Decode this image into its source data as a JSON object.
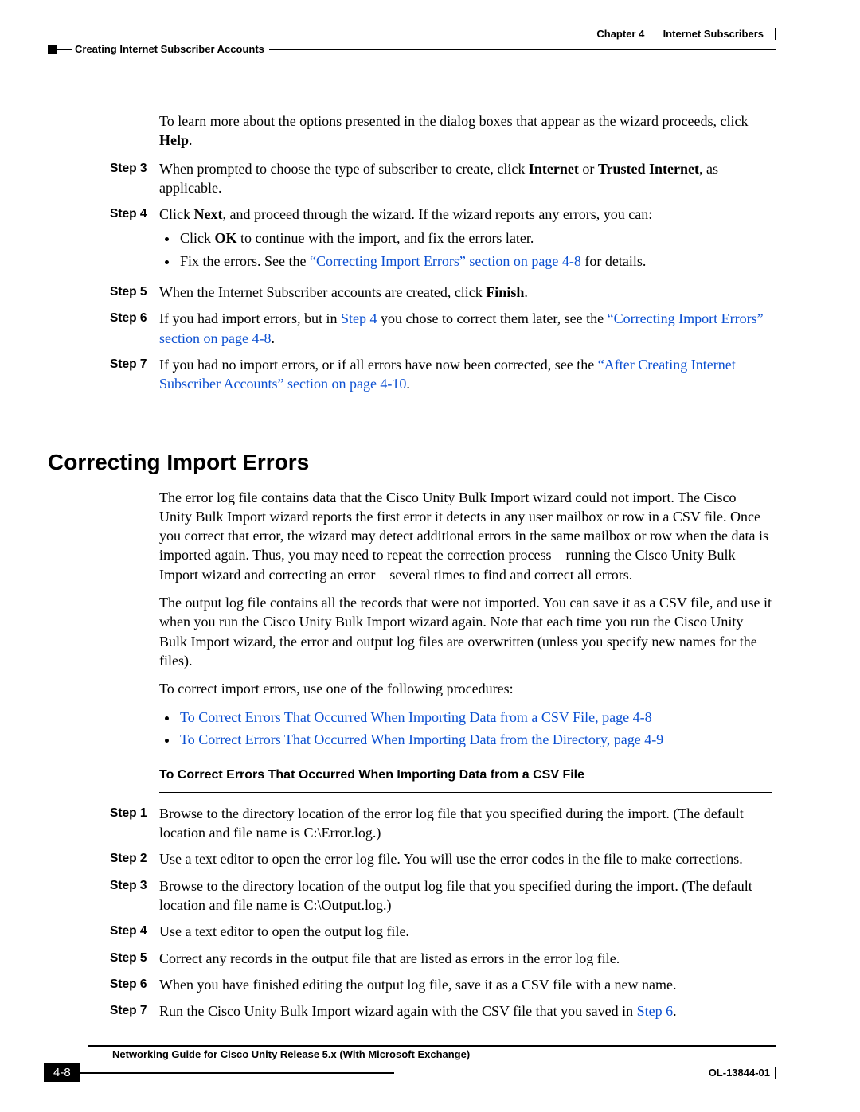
{
  "header": {
    "chapter_label": "Chapter 4",
    "chapter_title": "Internet Subscribers",
    "section": "Creating Internet Subscriber Accounts"
  },
  "intro": {
    "p1a": "To learn more about the options presented in the dialog boxes that appear as the wizard proceeds, click ",
    "help": "Help",
    "p1b": "."
  },
  "stepsA": {
    "s3": {
      "label": "Step 3",
      "a": "When prompted to choose the type of subscriber to create, click ",
      "b": "Internet",
      "c": " or ",
      "d": "Trusted Internet",
      "e": ", as applicable."
    },
    "s4": {
      "label": "Step 4",
      "a": "Click ",
      "b": "Next",
      "c": ", and proceed through the wizard. If the wizard reports any errors, you can:",
      "bullet1a": "Click ",
      "bullet1b": "OK",
      "bullet1c": " to continue with the import, and fix the errors later.",
      "bullet2a": "Fix the errors. See the ",
      "bullet2link": "“Correcting Import Errors” section on page 4-8",
      "bullet2b": " for details."
    },
    "s5": {
      "label": "Step 5",
      "a": "When the Internet Subscriber accounts are created, click ",
      "b": "Finish",
      "c": "."
    },
    "s6": {
      "label": "Step 6",
      "a": "If you had import errors, but in ",
      "link1": "Step 4",
      "b": " you chose to correct them later, see the ",
      "link2": "“Correcting Import Errors” section on page 4-8",
      "c": "."
    },
    "s7": {
      "label": "Step 7",
      "a": "If you had no import errors, or if all errors have now been corrected, see the ",
      "link": "“After Creating Internet Subscriber Accounts” section on page 4-10",
      "b": "."
    }
  },
  "h2": "Correcting Import Errors",
  "body": {
    "p1": "The error log file contains data that the Cisco Unity Bulk Import wizard could not import. The Cisco Unity Bulk Import wizard reports the first error it detects in any user mailbox or row in a CSV file. Once you correct that error, the wizard may detect additional errors in the same mailbox or row when the data is imported again. Thus, you may need to repeat the correction process—running the Cisco Unity Bulk Import wizard and correcting an error—several times to find and correct all errors.",
    "p2": "The output log file contains all the records that were not imported. You can save it as a CSV file, and use it when you run the Cisco Unity Bulk Import wizard again. Note that each time you run the Cisco Unity Bulk Import wizard, the error and output log files are overwritten (unless you specify new names for the files).",
    "p3": "To correct import errors, use one of the following procedures:",
    "link1": "To Correct Errors That Occurred When Importing Data from a CSV File, page 4-8",
    "link2": "To Correct Errors That Occurred When Importing Data from the Directory, page 4-9"
  },
  "proc_title": "To Correct Errors That Occurred When Importing Data from a CSV File",
  "stepsB": {
    "s1": {
      "label": "Step 1",
      "text": "Browse to the directory location of the error log file that you specified during the import. (The default location and file name is C:\\Error.log.)"
    },
    "s2": {
      "label": "Step 2",
      "text": "Use a text editor to open the error log file. You will use the error codes in the file to make corrections."
    },
    "s3": {
      "label": "Step 3",
      "text": "Browse to the directory location of the output log file that you specified during the import. (The default location and file name is C:\\Output.log.)"
    },
    "s4": {
      "label": "Step 4",
      "text": "Use a text editor to open the output log file."
    },
    "s5": {
      "label": "Step 5",
      "text": "Correct any records in the output file that are listed as errors in the error log file."
    },
    "s6": {
      "label": "Step 6",
      "text": "When you have finished editing the output log file, save it as a CSV file with a new name."
    },
    "s7": {
      "label": "Step 7",
      "a": "Run the Cisco Unity Bulk Import wizard again with the CSV file that you saved in ",
      "link": "Step 6",
      "b": "."
    }
  },
  "footer": {
    "guide": "Networking Guide for Cisco Unity Release 5.x (With Microsoft Exchange)",
    "page": "4-8",
    "docid": "OL-13844-01"
  }
}
